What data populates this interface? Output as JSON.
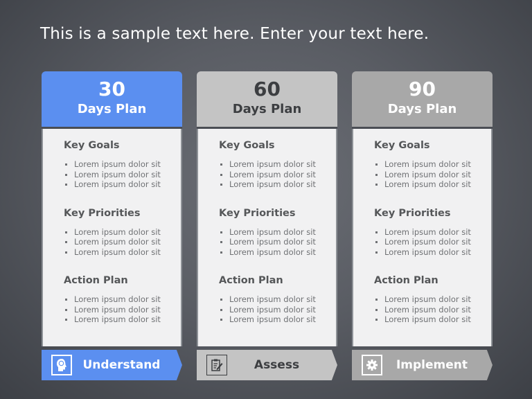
{
  "title": "This is a sample text here. Enter your text here.",
  "colors": {
    "plan30": "#5b8ff0",
    "plan60": "#c4c4c4",
    "plan90": "#a8a8a8",
    "card_body": "#f1f1f2"
  },
  "plans": [
    {
      "number": "30",
      "label": "Days Plan",
      "sections": [
        {
          "title": "Key Goals",
          "items": [
            "Lorem ipsum  dolor sit",
            "Lorem ipsum  dolor sit",
            "Lorem ipsum  dolor sit"
          ]
        },
        {
          "title": "Key Priorities",
          "items": [
            "Lorem ipsum  dolor sit",
            "Lorem ipsum  dolor sit",
            "Lorem ipsum  dolor sit"
          ]
        },
        {
          "title": "Action Plan",
          "items": [
            "Lorem ipsum  dolor sit",
            "Lorem ipsum  dolor sit",
            "Lorem ipsum  dolor sit"
          ]
        }
      ],
      "stage": {
        "label": "Understand",
        "icon": "head-brain-icon"
      }
    },
    {
      "number": "60",
      "label": "Days Plan",
      "sections": [
        {
          "title": "Key Goals",
          "items": [
            "Lorem ipsum  dolor sit",
            "Lorem ipsum  dolor sit",
            "Lorem ipsum  dolor sit"
          ]
        },
        {
          "title": "Key Priorities",
          "items": [
            "Lorem ipsum  dolor sit",
            "Lorem ipsum  dolor sit",
            "Lorem ipsum  dolor sit"
          ]
        },
        {
          "title": "Action Plan",
          "items": [
            "Lorem ipsum  dolor sit",
            "Lorem ipsum  dolor sit",
            "Lorem ipsum  dolor sit"
          ]
        }
      ],
      "stage": {
        "label": "Assess",
        "icon": "clipboard-icon"
      }
    },
    {
      "number": "90",
      "label": "Days Plan",
      "sections": [
        {
          "title": "Key Goals",
          "items": [
            "Lorem ipsum  dolor sit",
            "Lorem ipsum  dolor sit",
            "Lorem ipsum  dolor sit"
          ]
        },
        {
          "title": "Key Priorities",
          "items": [
            "Lorem ipsum  dolor sit",
            "Lorem ipsum  dolor sit",
            "Lorem ipsum  dolor sit"
          ]
        },
        {
          "title": "Action Plan",
          "items": [
            "Lorem ipsum  dolor sit",
            "Lorem ipsum  dolor sit",
            "Lorem ipsum  dolor sit"
          ]
        }
      ],
      "stage": {
        "label": "Implement",
        "icon": "gear-icon"
      }
    }
  ]
}
